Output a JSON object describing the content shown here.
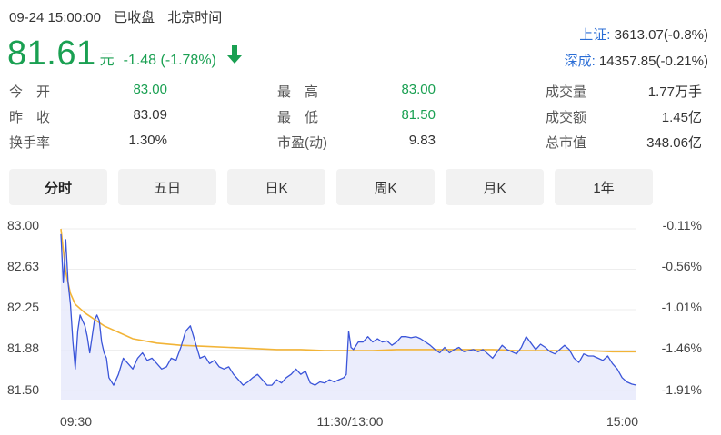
{
  "header": {
    "datetime": "09-24 15:00:00",
    "status": "已收盘",
    "timezone": "北京时间"
  },
  "quote": {
    "price": "81.61",
    "unit": "元",
    "change": "-1.48 (-1.78%)",
    "direction": "down"
  },
  "indices": [
    {
      "name": "上证:",
      "value": "3613.07(-0.8%)"
    },
    {
      "name": "深成:",
      "value": "14357.85(-0.21%)"
    }
  ],
  "stats": [
    {
      "label": "今　开",
      "value": "83.00",
      "color": "green"
    },
    {
      "label": "最　高",
      "value": "83.00",
      "color": "green"
    },
    {
      "label": "成交量",
      "value": "1.77万手",
      "color": "dark"
    },
    {
      "label": "昨　收",
      "value": "83.09",
      "color": "dark"
    },
    {
      "label": "最　低",
      "value": "81.50",
      "color": "green"
    },
    {
      "label": "成交额",
      "value": "1.45亿",
      "color": "dark"
    },
    {
      "label": "换手率",
      "value": "1.30%",
      "color": "dark"
    },
    {
      "label": "市盈(动)",
      "value": "9.83",
      "color": "dark"
    },
    {
      "label": "总市值",
      "value": "348.06亿",
      "color": "dark"
    }
  ],
  "tabs": [
    {
      "label": "分时",
      "active": true
    },
    {
      "label": "五日",
      "active": false
    },
    {
      "label": "日K",
      "active": false
    },
    {
      "label": "周K",
      "active": false
    },
    {
      "label": "月K",
      "active": false
    },
    {
      "label": "1年",
      "active": false
    }
  ],
  "colors": {
    "green": "#1aa052",
    "price_line": "#3b55d9",
    "avg_line": "#f2b437",
    "area_fill": "#e6e9fb",
    "index_name": "#2a6dd6"
  },
  "chart_data": {
    "type": "line",
    "ylim": [
      81.5,
      83.0
    ],
    "left_ticks": [
      "83.00",
      "82.63",
      "82.25",
      "81.88",
      "81.50"
    ],
    "right_ticks": [
      "-0.11%",
      "-0.56%",
      "-1.01%",
      "-1.46%",
      "-1.91%"
    ],
    "x_ticks": [
      "09:30",
      "11:30/13:00",
      "15:00"
    ],
    "x_range": [
      0,
      240
    ],
    "series": [
      {
        "key": "price",
        "x": [
          0,
          1,
          2,
          3,
          4,
          5,
          6,
          7,
          8,
          9,
          10,
          11,
          12,
          13,
          14,
          15,
          16,
          17,
          18,
          19,
          20,
          22,
          24,
          26,
          28,
          30,
          32,
          34,
          36,
          38,
          40,
          42,
          44,
          46,
          48,
          50,
          52,
          54,
          56,
          58,
          60,
          62,
          64,
          66,
          68,
          70,
          72,
          74,
          76,
          78,
          80,
          82,
          84,
          86,
          88,
          90,
          92,
          94,
          96,
          98,
          100,
          102,
          104,
          106,
          108,
          110,
          112,
          114,
          116,
          118,
          119,
          120,
          121,
          122,
          124,
          126,
          128,
          130,
          132,
          134,
          136,
          138,
          140,
          142,
          144,
          146,
          148,
          150,
          152,
          154,
          156,
          158,
          160,
          162,
          164,
          166,
          168,
          170,
          172,
          174,
          176,
          178,
          180,
          182,
          184,
          186,
          188,
          190,
          192,
          194,
          196,
          198,
          200,
          202,
          204,
          206,
          208,
          210,
          212,
          214,
          216,
          218,
          220,
          222,
          224,
          226,
          228,
          230,
          232,
          234,
          236,
          238,
          240
        ],
        "values": [
          82.95,
          82.5,
          82.9,
          82.5,
          82.3,
          81.95,
          81.7,
          82.05,
          82.2,
          82.15,
          82.1,
          82.0,
          81.85,
          82.0,
          82.15,
          82.2,
          82.15,
          81.95,
          81.85,
          81.8,
          81.62,
          81.55,
          81.65,
          81.8,
          81.75,
          81.7,
          81.8,
          81.85,
          81.78,
          81.8,
          81.75,
          81.7,
          81.72,
          81.8,
          81.78,
          81.9,
          82.05,
          82.1,
          81.95,
          81.8,
          81.82,
          81.75,
          81.78,
          81.72,
          81.7,
          81.72,
          81.65,
          81.6,
          81.55,
          81.58,
          81.62,
          81.65,
          81.6,
          81.55,
          81.55,
          81.6,
          81.57,
          81.62,
          81.65,
          81.7,
          81.65,
          81.68,
          81.57,
          81.55,
          81.58,
          81.57,
          81.6,
          81.58,
          81.6,
          81.62,
          81.65,
          82.05,
          81.9,
          81.88,
          81.95,
          81.95,
          82.0,
          81.95,
          81.98,
          81.95,
          81.96,
          81.92,
          81.95,
          82.0,
          82.0,
          81.99,
          82.0,
          81.98,
          81.95,
          81.92,
          81.88,
          81.85,
          81.9,
          81.85,
          81.88,
          81.9,
          81.86,
          81.87,
          81.88,
          81.86,
          81.88,
          81.84,
          81.8,
          81.86,
          81.92,
          81.88,
          81.86,
          81.84,
          81.9,
          82.0,
          81.94,
          81.88,
          81.93,
          81.9,
          81.86,
          81.84,
          81.88,
          81.92,
          81.88,
          81.8,
          81.76,
          81.84,
          81.82,
          81.82,
          81.8,
          81.78,
          81.82,
          81.75,
          81.7,
          81.62,
          81.58,
          81.56,
          81.55
        ]
      },
      {
        "key": "average",
        "x": [
          0,
          2,
          4,
          6,
          8,
          10,
          14,
          18,
          24,
          30,
          40,
          50,
          60,
          70,
          80,
          90,
          100,
          110,
          120,
          130,
          140,
          150,
          160,
          170,
          180,
          190,
          200,
          210,
          220,
          230,
          240
        ],
        "values": [
          83.0,
          82.6,
          82.4,
          82.3,
          82.26,
          82.22,
          82.16,
          82.1,
          82.04,
          81.98,
          81.94,
          81.92,
          81.91,
          81.9,
          81.89,
          81.88,
          81.88,
          81.87,
          81.87,
          81.87,
          81.88,
          81.88,
          81.88,
          81.88,
          81.88,
          81.87,
          81.87,
          81.87,
          81.87,
          81.86,
          81.86
        ]
      }
    ]
  }
}
